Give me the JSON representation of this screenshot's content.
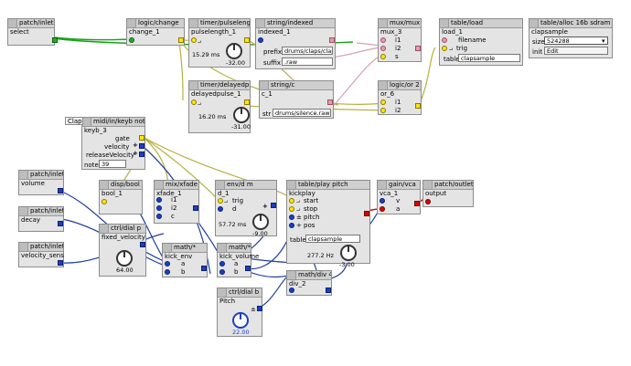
{
  "objects": {
    "select": {
      "type": "patch/inlet i",
      "name": "select"
    },
    "change": {
      "type": "logic/change",
      "name": "change_1"
    },
    "pulselength": {
      "type": "timer/pulselength",
      "name": "pulselength_1",
      "value": "15.29 ms",
      "knob": "-32.00"
    },
    "indexed": {
      "type": "string/indexed",
      "name": "indexed_1",
      "prefix_label": "prefix",
      "prefix": "drums/claps/clap0",
      "suffix_label": "suffix",
      ".raw": ".raw",
      "suffix": ".raw"
    },
    "mux": {
      "type": "mux/mux 2",
      "name": "mux_3",
      "i1": "i1",
      "i2": "i2",
      "s": "s"
    },
    "tableload": {
      "type": "table/load",
      "name": "load_1",
      "filename": "filename",
      "trig": "trig",
      "table_label": "table",
      "table": "clapsample"
    },
    "alloc": {
      "type": "table/alloc 16b sdram",
      "name": "clapsample",
      "size_label": "size",
      "size": "524288",
      "init_label": "init",
      "init": "Edit"
    },
    "delayedpulse": {
      "type": "timer/delayedpulse",
      "name": "delayedpulse_1",
      "value": "16.20 ms",
      "knob": "-31.00"
    },
    "stringc": {
      "type": "string/c",
      "name": "c_1",
      "str_label": "str",
      "str": "drums/silence.raw"
    },
    "logicor": {
      "type": "logic/or 2",
      "name": "or_6",
      "i1": "i1",
      "i2": "i2"
    },
    "keyb": {
      "badge": "Clap",
      "type": "midi/in/keyb note",
      "name": "keyb_3",
      "gate": "gate",
      "velocity": "velocity",
      "releaseVelocity": "releaseVelocity",
      "note_label": "note",
      "note": "39"
    },
    "volume": {
      "type": "patch/inlet f",
      "name": "volume"
    },
    "decay": {
      "type": "patch/inlet f",
      "name": "decay"
    },
    "velsens": {
      "type": "patch/inlet f",
      "name": "velocity_sens"
    },
    "bool": {
      "type": "disp/bool",
      "name": "bool_1"
    },
    "xfade": {
      "type": "mix/xfade",
      "name": "xfade_1",
      "i1": "i1",
      "i2": "i2",
      "c": "c"
    },
    "envdm": {
      "type": "env/d m",
      "name": "d_1",
      "trig": "trig",
      "d": "d",
      "value": "57.72 ms",
      "knob": "-9.00"
    },
    "dialp": {
      "type": "ctrl/dial p",
      "name": "fixed_velocity",
      "value": "64.00"
    },
    "mult1": {
      "type": "math/*",
      "name": "kick_env",
      "a": "a",
      "b": "b"
    },
    "mult2": {
      "type": "math/*",
      "name": "kick_volume",
      "a": "a",
      "b": "b"
    },
    "playpitch": {
      "type": "table/play pitch",
      "name": "kickplay",
      "start": "start",
      "stop": "stop",
      "pitch": "pitch",
      "pos": "pos",
      "table_label": "table",
      "table": "clapsample",
      "value": "277.2 Hz",
      "knob": "-3.00"
    },
    "gainvca": {
      "type": "gain/vca",
      "name": "vca_1",
      "v": "v",
      "a": "a"
    },
    "outlet": {
      "type": "patch/outlet a",
      "name": "output"
    },
    "div": {
      "type": "math/div 4",
      "name": "div_2"
    },
    "dialb": {
      "type": "ctrl/dial b",
      "name": "Pitch",
      "value": "22.00"
    }
  },
  "colors": {
    "blue": "#1a3fc8",
    "yellow": "#ffe600",
    "red": "#e00000",
    "green": "#22b022",
    "pink": "#e89ab0",
    "wire_yellow": "#b8b040",
    "wire_blue": "#1f3fa0",
    "wire_red": "#c01010",
    "wire_green": "#18a018",
    "wire_pink": "#d8a0b0"
  }
}
